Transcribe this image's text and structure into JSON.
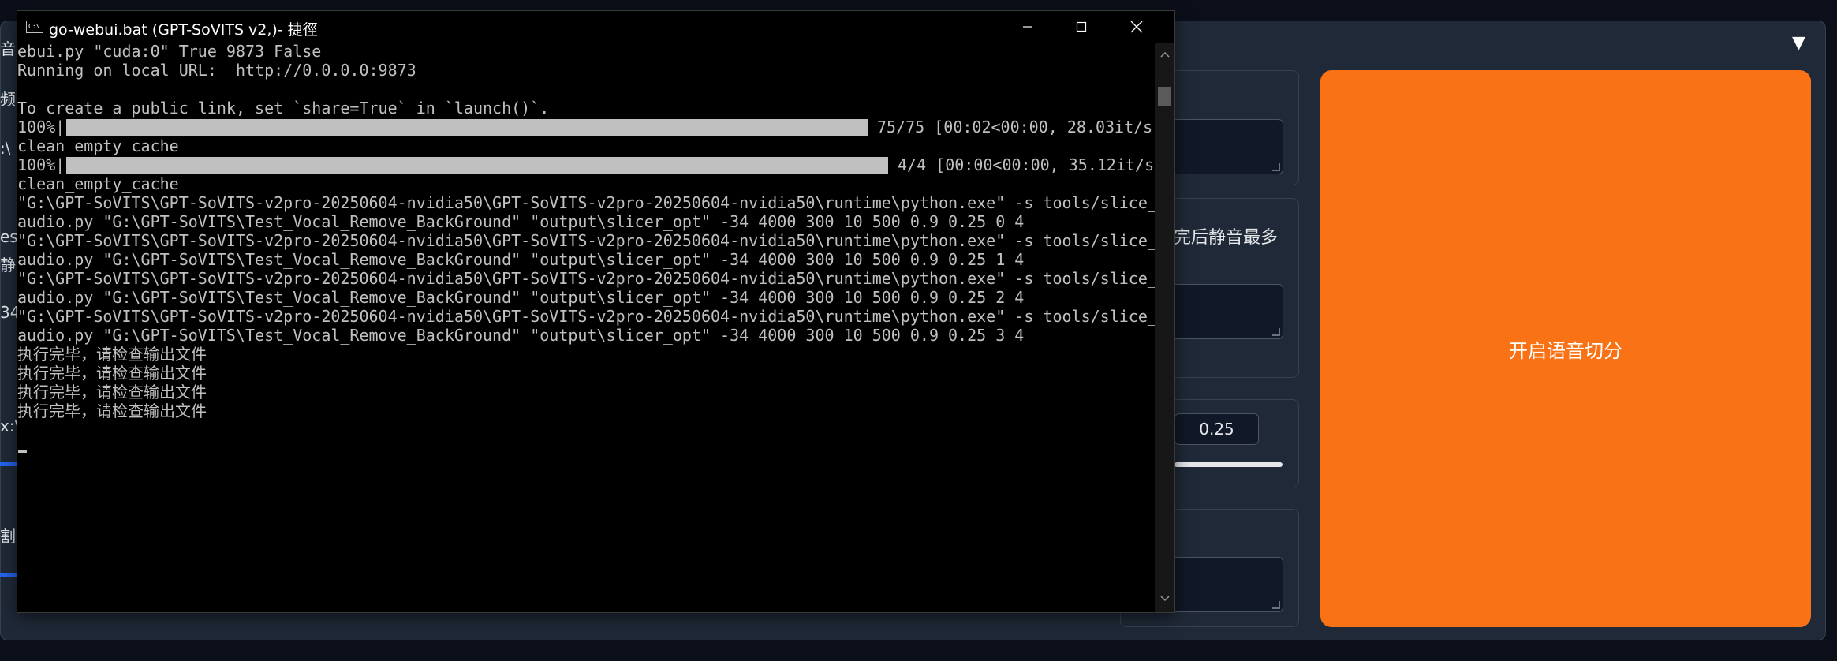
{
  "background_ui": {
    "run_button_label": "开启语音切分",
    "label_fragment": "完后静音最多",
    "number_value": "0.25",
    "collapse_arrow": "▼",
    "left_fragments": [
      "音",
      "频",
      ":\\",
      "es",
      "静",
      "34",
      "x:\\",
      "割"
    ]
  },
  "console": {
    "window_title": "go-webui.bat (GPT-SoVITS v2,)- 捷徑",
    "icon_text": "C:\\",
    "icons": [
      "minimize-icon",
      "maximize-icon",
      "close-icon",
      "scroll-up-icon",
      "scroll-down-icon"
    ],
    "lines": [
      "ebui.py \"cuda:0\" True 9873 False",
      "Running on local URL:  http://0.0.0.0:9873",
      "",
      "To create a public link, set `share=True` in `launch()`.",
      "100%|",
      "clean_empty_cache",
      "100%|",
      "clean_empty_cache",
      "\"G:\\GPT-SoVITS\\GPT-SoVITS-v2pro-20250604-nvidia50\\GPT-SoVITS-v2pro-20250604-nvidia50\\runtime\\python.exe\" -s tools/slice_",
      "audio.py \"G:\\GPT-SoVITS\\Test_Vocal_Remove_BackGround\" \"output\\slicer_opt\" -34 4000 300 10 500 0.9 0.25 0 4",
      "\"G:\\GPT-SoVITS\\GPT-SoVITS-v2pro-20250604-nvidia50\\GPT-SoVITS-v2pro-20250604-nvidia50\\runtime\\python.exe\" -s tools/slice_",
      "audio.py \"G:\\GPT-SoVITS\\Test_Vocal_Remove_BackGround\" \"output\\slicer_opt\" -34 4000 300 10 500 0.9 0.25 1 4",
      "\"G:\\GPT-SoVITS\\GPT-SoVITS-v2pro-20250604-nvidia50\\GPT-SoVITS-v2pro-20250604-nvidia50\\runtime\\python.exe\" -s tools/slice_",
      "audio.py \"G:\\GPT-SoVITS\\Test_Vocal_Remove_BackGround\" \"output\\slicer_opt\" -34 4000 300 10 500 0.9 0.25 2 4",
      "\"G:\\GPT-SoVITS\\GPT-SoVITS-v2pro-20250604-nvidia50\\GPT-SoVITS-v2pro-20250604-nvidia50\\runtime\\python.exe\" -s tools/slice_",
      "audio.py \"G:\\GPT-SoVITS\\Test_Vocal_Remove_BackGround\" \"output\\slicer_opt\" -34 4000 300 10 500 0.9 0.25 3 4",
      "执行完毕，请检查输出文件",
      "执行完毕，请检查输出文件",
      "执行完毕，请检查输出文件",
      "执行完毕，请检查输出文件"
    ],
    "progress": [
      {
        "percent": "100%",
        "status": "75/75 [00:02<00:00, 28.03it/s]"
      },
      {
        "percent": "100%",
        "status": "4/4 [00:00<00:00, 35.12it/s]"
      }
    ]
  },
  "colors": {
    "accent_orange": "#f97316",
    "panel": "#1f2937",
    "page_bg": "#0b0f19",
    "terminal_text": "#c0c0c0",
    "terminal_bg": "#000000"
  }
}
